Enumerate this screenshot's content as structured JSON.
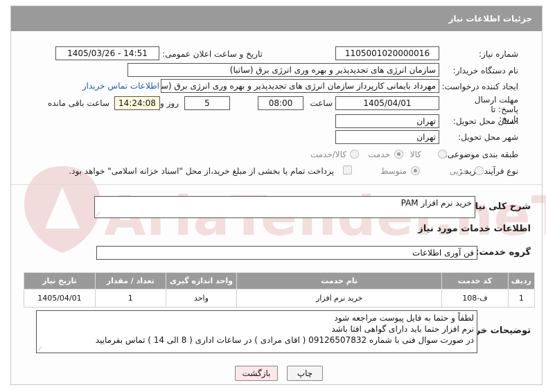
{
  "header": {
    "title": "جزئیات اطلاعات نیاز"
  },
  "fields": {
    "need_number_label": "شماره نیاز:",
    "need_number": "1105001020000016",
    "announce_label": "تاریخ و ساعت اعلان عمومی:",
    "announce_value": "1405/03/26 - 14:51",
    "buyer_org_label": "نام دستگاه خریدار:",
    "buyer_org": "سازمان انرژی های تجدیدپذیر و بهره وری انرژی برق (ساتبا)",
    "requester_label": "ایجاد کننده درخواست:",
    "requester": "مهرداد بایمانی کارپرداز سازمان انرژی های تجدیدپذیر و بهره وری انرژی برق (ساتبا)",
    "contact_link": "اطلاعات تماس خریدار",
    "deadline_label": "مهلت ارسال پاسخ: تا تاریخ:",
    "deadline_date": "1405/04/01",
    "hour_label": "ساعت",
    "deadline_time": "08:00",
    "day_label": "روز و",
    "days": "5",
    "remaining_time": "14:24:08",
    "remaining_label": "ساعت باقی مانده",
    "province_label": "استان محل تحویل:",
    "province": "تهران",
    "city_label": "شهر محل تحویل:",
    "city": "تهران",
    "category_label": "طبقه بندی موضوعی:",
    "category_options": [
      "کالا",
      "خدمت",
      "کالا/خدمت"
    ],
    "process_label": "نوع فرآیند خرید :",
    "process_options": [
      "جزیی",
      "متوسط"
    ],
    "payment_note": "پرداخت تمام یا بخشی از مبلغ خرید،از محل \"اسناد خزانه اسلامی\" خواهد بود."
  },
  "summary": {
    "label": "شرح کلی نیاز:",
    "value": "خرید نرم افزار PAM"
  },
  "services": {
    "section_title": "اطلاعات خدمات مورد نیاز",
    "group_label": "گروه خدمت:",
    "group_value": "فن آوری اطلاعات",
    "table": {
      "headers": [
        "ردیف",
        "کد خدمت",
        "نام خدمت",
        "واحد اندازه گیری",
        "تعداد / مقدار",
        "تاریخ نیاز"
      ],
      "rows": [
        [
          "1",
          "ف-108",
          "خرید نرم افزار",
          "واحد",
          "1",
          "1405/04/01"
        ]
      ]
    }
  },
  "buyer_notes": {
    "label": "توضیحات خریدار:",
    "lines": [
      "لطفاً و حتما به فایل پیوست مراجعه شود",
      "نرم افزار حتما باید دارای گواهی افتا باشد",
      "در صورت سوال فنی با شماره 09126507832 ( اقای مرادی ) در ساعات اداری ( 8 الی 14 ) تماس بفرمایید"
    ]
  },
  "buttons": {
    "print": "چاپ",
    "back": "بازگشت"
  },
  "watermark": {
    "text": "AriaTender.neT",
    "color": "#b00000"
  }
}
